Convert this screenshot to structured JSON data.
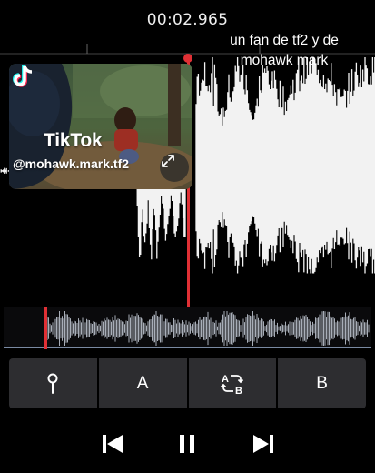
{
  "player": {
    "time": "00:02.965"
  },
  "caption": {
    "line1": "un fan de tf2 y de",
    "line2": "mohawk mark"
  },
  "pip": {
    "brand": "TikTok",
    "handle": "@mohawk.mark.tf2"
  },
  "segments": {
    "pin_icon": "pin-icon",
    "a_label": "A",
    "loop_icon": "ab-loop-icon",
    "b_label": "B"
  },
  "transport": {
    "prev_icon": "skip-previous-icon",
    "pause_icon": "pause-icon",
    "next_icon": "skip-next-icon"
  },
  "colors": {
    "playhead": "#e03035",
    "waveform": "#f2f2f2",
    "overview_wave": "#a8aeb8",
    "segment_bg": "#2d2d30"
  }
}
